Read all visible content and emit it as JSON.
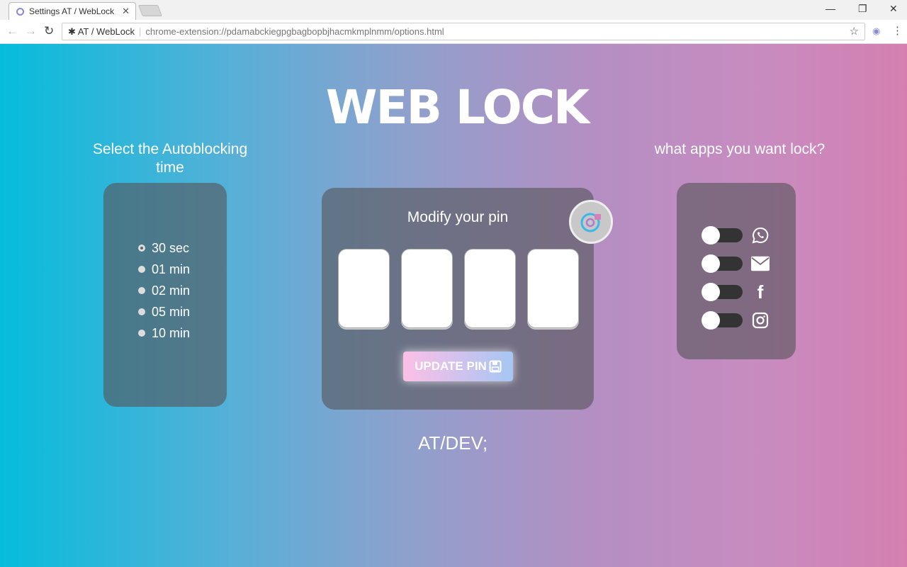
{
  "browser": {
    "tab_title": "Settings AT / WebLock",
    "site_name": "AT / WebLock",
    "url": "chrome-extension://pdamabckiegpgbagbopbjhacmkmplnmm/options.html"
  },
  "logo": {
    "text": "WEB LOCK"
  },
  "autoblock": {
    "heading": "Select the Autoblocking time",
    "options": [
      "30 sec",
      "01 min",
      "02 min",
      "05 min",
      "10 min"
    ],
    "selected": "30 sec"
  },
  "pin": {
    "title": "Modify your pin",
    "values": [
      "",
      "",
      "",
      ""
    ],
    "button_label": "UPDATE PIN"
  },
  "apps": {
    "heading": "what apps you want lock?",
    "items": [
      {
        "icon": "whatsapp-icon",
        "enabled": false
      },
      {
        "icon": "mail-icon",
        "enabled": false
      },
      {
        "icon": "facebook-icon",
        "enabled": false
      },
      {
        "icon": "instagram-icon",
        "enabled": false
      }
    ]
  },
  "footer": {
    "brand": "AT/DEV;"
  },
  "colors": {
    "gradient_left": "#06bcdb",
    "gradient_right": "#d47fb0",
    "button_left": "#fdbfe6",
    "button_right": "#a6c6f4"
  }
}
